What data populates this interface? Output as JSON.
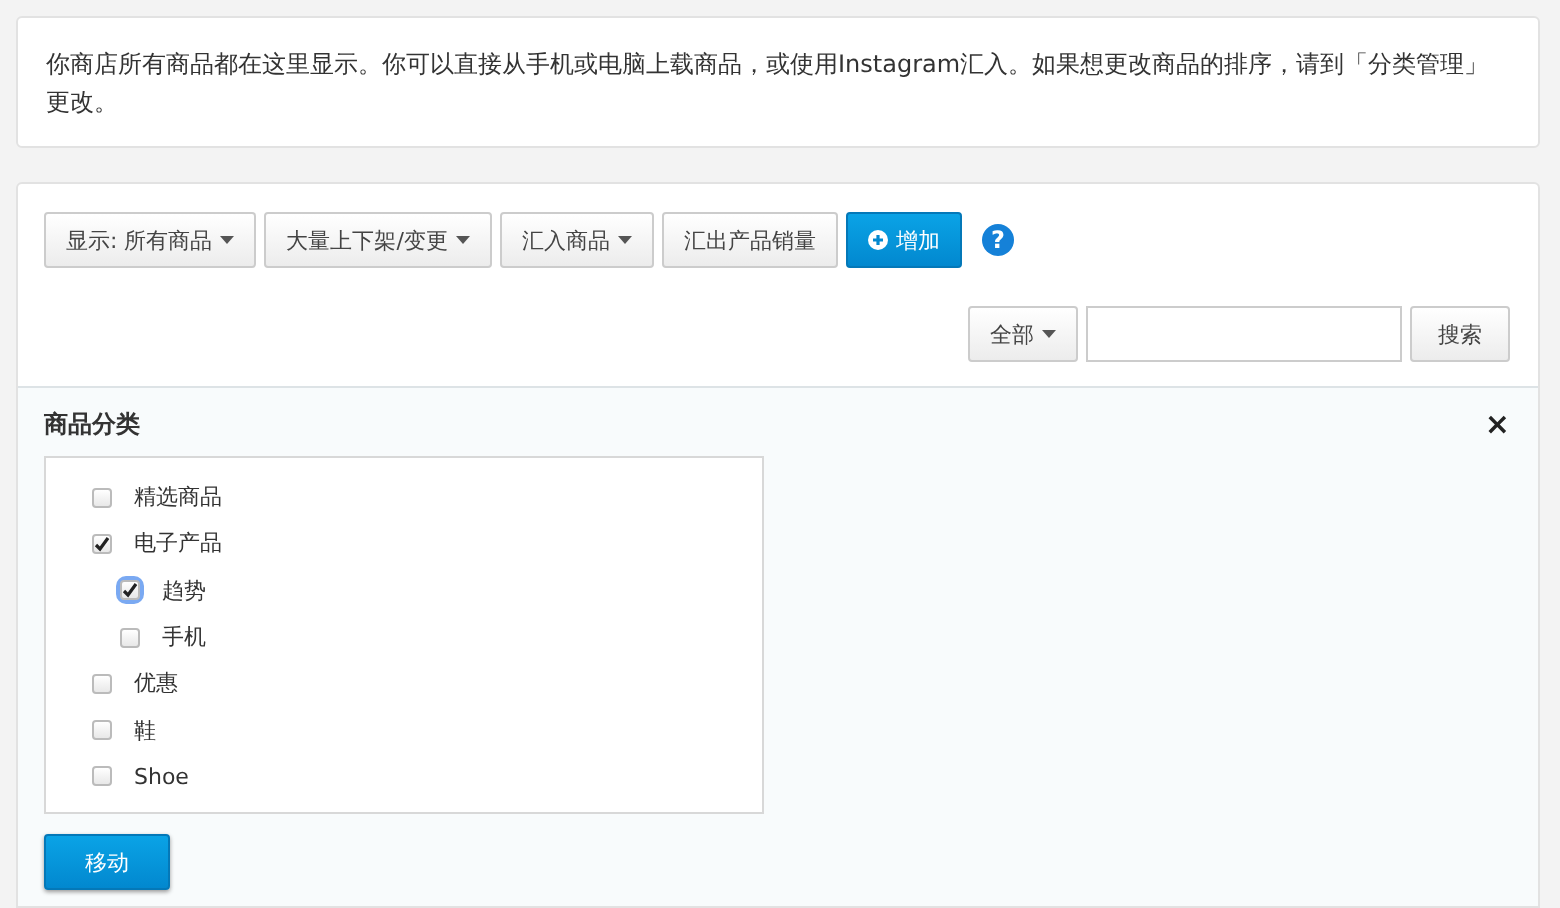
{
  "notice": "你商店所有商品都在这里显示。你可以直接从手机或电脑上载商品，或使用Instagram汇入。如果想更改商品的排序，请到「分类管理」更改。",
  "toolbar": {
    "buttons": [
      {
        "label": "显示: 所有商品",
        "dropdown": true,
        "kind": "default"
      },
      {
        "label": "大量上下架/变更",
        "dropdown": true,
        "kind": "default"
      },
      {
        "label": "汇入商品",
        "dropdown": true,
        "kind": "default"
      },
      {
        "label": "汇出产品销量",
        "dropdown": false,
        "kind": "default"
      },
      {
        "label": "增加",
        "dropdown": false,
        "kind": "primary"
      }
    ],
    "help": "?"
  },
  "search": {
    "scope": "全部",
    "button": "搜索"
  },
  "categories": {
    "title": "商品分类",
    "close": "×",
    "items": [
      {
        "label": "精选商品",
        "checked": false,
        "focused": false
      },
      {
        "label": "电子产品",
        "checked": true,
        "focused": false,
        "children": [
          {
            "label": "趋势",
            "checked": true,
            "focused": true
          },
          {
            "label": "手机",
            "checked": false,
            "focused": false
          }
        ]
      },
      {
        "label": "优惠",
        "checked": false,
        "focused": false
      },
      {
        "label": "鞋",
        "checked": false,
        "focused": false
      },
      {
        "label": "Shoe",
        "checked": false,
        "focused": false
      }
    ],
    "move_button": "移动"
  }
}
